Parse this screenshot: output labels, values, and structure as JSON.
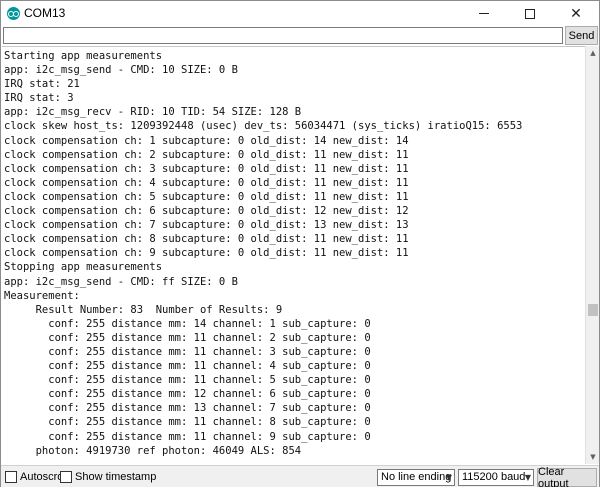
{
  "window": {
    "title": "COM13",
    "icon": "arduino-icon",
    "controls": {
      "minimize": "minimize-icon",
      "maximize": "maximize-icon",
      "close": "close-icon"
    }
  },
  "send_bar": {
    "input_value": "",
    "send_label": "Send"
  },
  "output_lines": [
    "Starting app measurements",
    "app: i2c_msg_send - CMD: 10 SIZE: 0 B",
    "IRQ stat: 21",
    "IRQ stat: 3",
    "app: i2c_msg_recv - RID: 10 TID: 54 SIZE: 128 B",
    "clock skew host_ts: 1209392448 (usec) dev_ts: 56034471 (sys_ticks) iratioQ15: 6553",
    "clock compensation ch: 1 subcapture: 0 old_dist: 14 new_dist: 14",
    "clock compensation ch: 2 subcapture: 0 old_dist: 11 new_dist: 11",
    "clock compensation ch: 3 subcapture: 0 old_dist: 11 new_dist: 11",
    "clock compensation ch: 4 subcapture: 0 old_dist: 11 new_dist: 11",
    "clock compensation ch: 5 subcapture: 0 old_dist: 11 new_dist: 11",
    "clock compensation ch: 6 subcapture: 0 old_dist: 12 new_dist: 12",
    "clock compensation ch: 7 subcapture: 0 old_dist: 13 new_dist: 13",
    "clock compensation ch: 8 subcapture: 0 old_dist: 11 new_dist: 11",
    "clock compensation ch: 9 subcapture: 0 old_dist: 11 new_dist: 11",
    "Stopping app measurements",
    "app: i2c_msg_send - CMD: ff SIZE: 0 B",
    "Measurement:",
    "     Result Number: 83  Number of Results: 9",
    "       conf: 255 distance mm: 14 channel: 1 sub_capture: 0",
    "       conf: 255 distance mm: 11 channel: 2 sub_capture: 0",
    "       conf: 255 distance mm: 11 channel: 3 sub_capture: 0",
    "       conf: 255 distance mm: 11 channel: 4 sub_capture: 0",
    "       conf: 255 distance mm: 11 channel: 5 sub_capture: 0",
    "       conf: 255 distance mm: 12 channel: 6 sub_capture: 0",
    "       conf: 255 distance mm: 13 channel: 7 sub_capture: 0",
    "       conf: 255 distance mm: 11 channel: 8 sub_capture: 0",
    "       conf: 255 distance mm: 11 channel: 9 sub_capture: 0",
    "     photon: 4919730 ref photon: 46049 ALS: 854"
  ],
  "bottom_bar": {
    "autoscroll_label": "Autoscroll",
    "autoscroll_checked": false,
    "timestamp_label": "Show timestamp",
    "timestamp_checked": false,
    "line_ending": "No line ending",
    "baud_rate": "115200 baud",
    "clear_label": "Clear output"
  },
  "colors": {
    "accent": "#00979c",
    "button_bg": "#e1e1e1"
  }
}
